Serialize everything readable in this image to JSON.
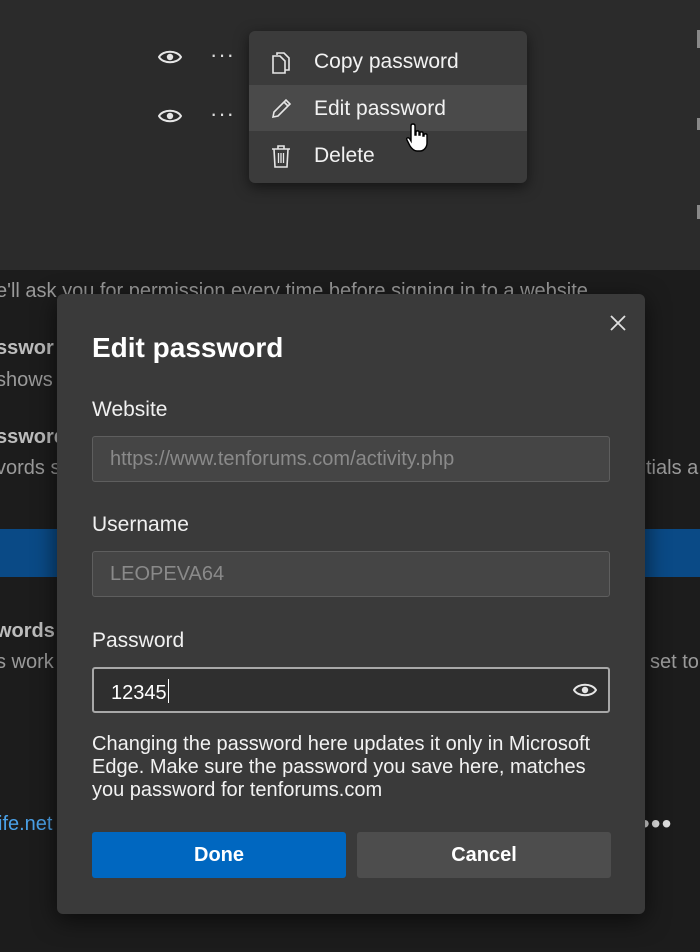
{
  "context_menu": {
    "items": [
      {
        "label": "Copy password",
        "icon": "copy-icon"
      },
      {
        "label": "Edit password",
        "icon": "pencil-icon"
      },
      {
        "label": "Delete",
        "icon": "trash-icon"
      }
    ]
  },
  "background": {
    "permission_text": "e'll ask you for permission every time before signing in to a website",
    "bold_1": "sswor",
    "text_1": "shows",
    "bold_2": "ssword",
    "text_2": "vords s",
    "text_2_right": "tials a",
    "bold_3": "words",
    "text_3": "s work",
    "text_3_right": "set to",
    "link": "ife.net"
  },
  "dialog": {
    "title": "Edit password",
    "website_label": "Website",
    "website_value": "https://www.tenforums.com/activity.php",
    "username_label": "Username",
    "username_value": "LEOPEVA64",
    "password_label": "Password",
    "password_value": "12345",
    "help_text": "Changing the password here updates it only in Microsoft Edge. Make sure the password you save here, matches you password for tenforums.com",
    "done_label": "Done",
    "cancel_label": "Cancel"
  },
  "colors": {
    "accent": "#0067c0",
    "dialog_bg": "#3a3a3a",
    "page_bg": "#1c1c1c"
  }
}
